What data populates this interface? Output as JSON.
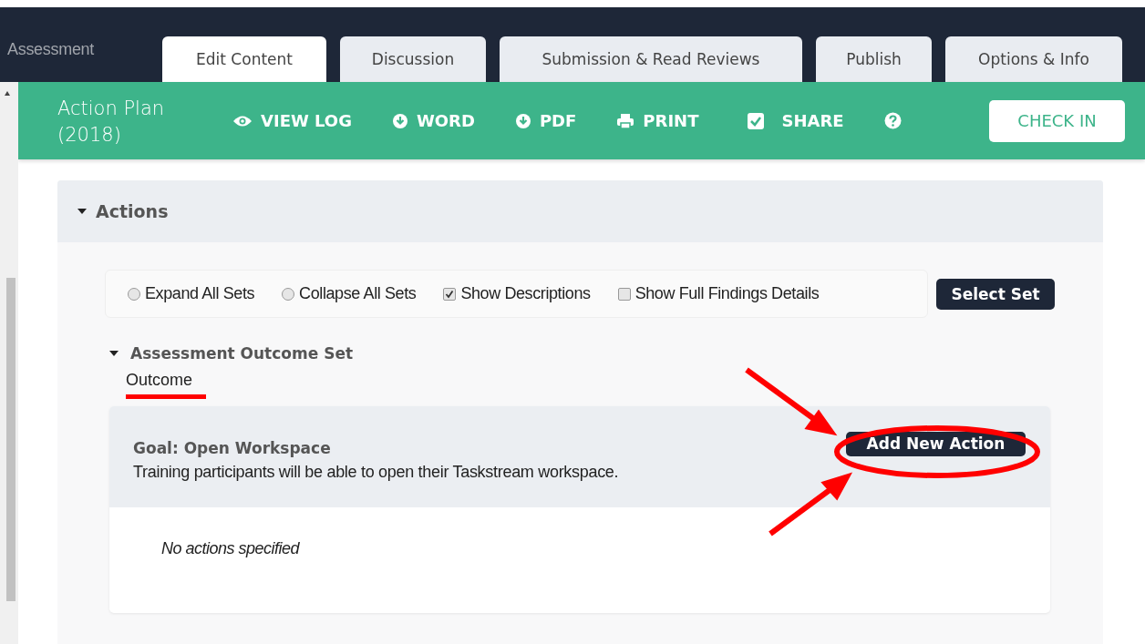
{
  "header": {
    "section": "Assessment"
  },
  "tabs": [
    {
      "label": "Edit Content",
      "selected": true
    },
    {
      "label": "Discussion",
      "selected": false
    },
    {
      "label": "Submission & Read Reviews",
      "selected": false
    },
    {
      "label": "Publish",
      "selected": false
    },
    {
      "label": "Options & Info",
      "selected": false
    }
  ],
  "toolbar": {
    "title": "Action Plan (2018)",
    "actions": [
      {
        "kind": "eye",
        "label": "VIEW LOG"
      },
      {
        "kind": "download",
        "label": "WORD"
      },
      {
        "kind": "download",
        "label": "PDF"
      },
      {
        "kind": "print",
        "label": "PRINT"
      },
      {
        "kind": "check",
        "label": "SHARE"
      },
      {
        "kind": "help"
      }
    ],
    "check_in": "CHECK IN"
  },
  "panel": {
    "title": "Actions",
    "expanded": true,
    "options": [
      {
        "kind": "radio",
        "label": "Expand All Sets",
        "selected": false
      },
      {
        "kind": "radio",
        "label": "Collapse All Sets",
        "selected": false
      },
      {
        "kind": "checkbox",
        "label": "Show Descriptions",
        "checked": true
      },
      {
        "kind": "checkbox",
        "label": "Show Full Findings Details",
        "checked": false
      }
    ],
    "select_set": "Select Set",
    "set": {
      "title": "Assessment Outcome Set",
      "expanded": true,
      "subtitle": "Outcome",
      "goal": {
        "title": "Goal: Open Workspace",
        "description": "Training participants will be able to open their Taskstream workspace.",
        "button": "Add New Action",
        "empty": "No actions specified"
      }
    }
  }
}
